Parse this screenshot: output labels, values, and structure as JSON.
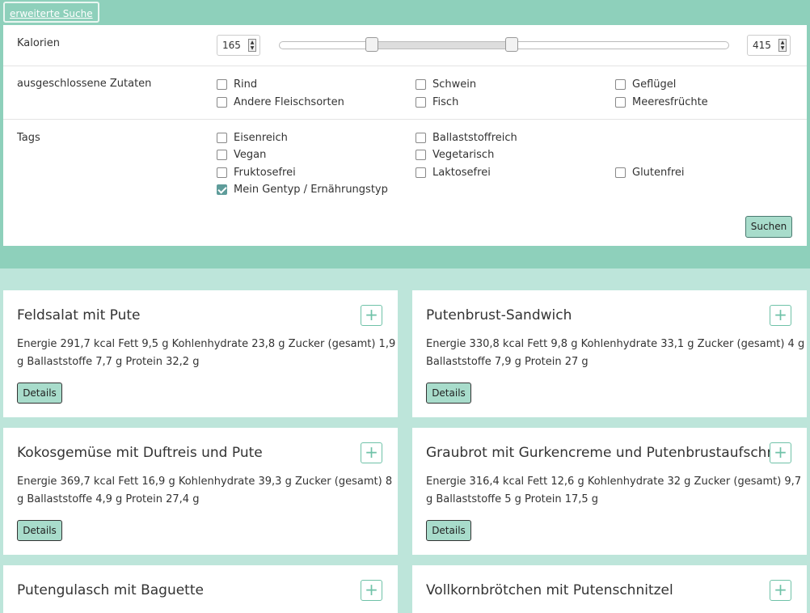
{
  "search_panel": {
    "tab_label": "erweiterte Suche",
    "calories": {
      "label": "Kalorien",
      "min_value": "165",
      "max_value": "415"
    },
    "excluded": {
      "label": "ausgeschlossene Zutaten",
      "options": [
        {
          "label": "Rind",
          "checked": false
        },
        {
          "label": "Schwein",
          "checked": false
        },
        {
          "label": "Geflügel",
          "checked": false
        },
        {
          "label": "Andere Fleischsorten",
          "checked": false
        },
        {
          "label": "Fisch",
          "checked": false
        },
        {
          "label": "Meeresfrüchte",
          "checked": false
        }
      ]
    },
    "tags": {
      "label": "Tags",
      "options": [
        {
          "label": "Eisenreich",
          "checked": false
        },
        {
          "label": "Ballaststoffreich",
          "checked": false
        },
        {
          "label": "Vegan",
          "checked": false
        },
        {
          "label": "Vegetarisch",
          "checked": false
        },
        {
          "label": "Fruktosefrei",
          "checked": false
        },
        {
          "label": "Laktosefrei",
          "checked": false
        },
        {
          "label": "Glutenfrei",
          "checked": false
        },
        {
          "label": "Mein Gentyp / Ernährungstyp",
          "checked": true
        }
      ]
    },
    "search_button": "Suchen"
  },
  "recipes": [
    {
      "title": "Feldsalat mit Pute",
      "nutrition": "Energie 291,7 kcal Fett 9,5 g Kohlenhydrate 23,8 g Zucker (gesamt) 1,9 g Ballaststoffe 7,7 g Protein 32,2 g",
      "details": "Details",
      "add": "+"
    },
    {
      "title": "Putenbrust-Sandwich",
      "nutrition": "Energie 330,8 kcal Fett 9,8 g Kohlenhydrate 33,1 g Zucker (gesamt) 4 g Ballaststoffe 7,9 g Protein 27 g",
      "details": "Details",
      "add": "+"
    },
    {
      "title": "Kokosgemüse mit Duftreis und Pute",
      "nutrition": "Energie 369,7 kcal Fett 16,9 g Kohlenhydrate 39,3 g Zucker (gesamt) 8 g Ballaststoffe 4,9 g Protein 27,4 g",
      "details": "Details",
      "add": "+"
    },
    {
      "title": "Graubrot mit Gurkencreme und Putenbrustaufschnitt",
      "nutrition": "Energie 316,4 kcal Fett 12,6 g Kohlenhydrate 32 g Zucker (gesamt) 9,7 g Ballaststoffe 5 g Protein 17,5 g",
      "details": "Details",
      "add": "+"
    },
    {
      "title": "Putengulasch mit Baguette",
      "add": "+"
    },
    {
      "title": "Vollkornbrötchen mit Putenschnitzel",
      "add": "+"
    }
  ],
  "colors": {
    "header_bg": "#8ed0bb",
    "page_bg": "#bde5da",
    "button_bg": "#a8dccb",
    "accent": "#6fc2a8",
    "checked": "#5e9c9a"
  }
}
